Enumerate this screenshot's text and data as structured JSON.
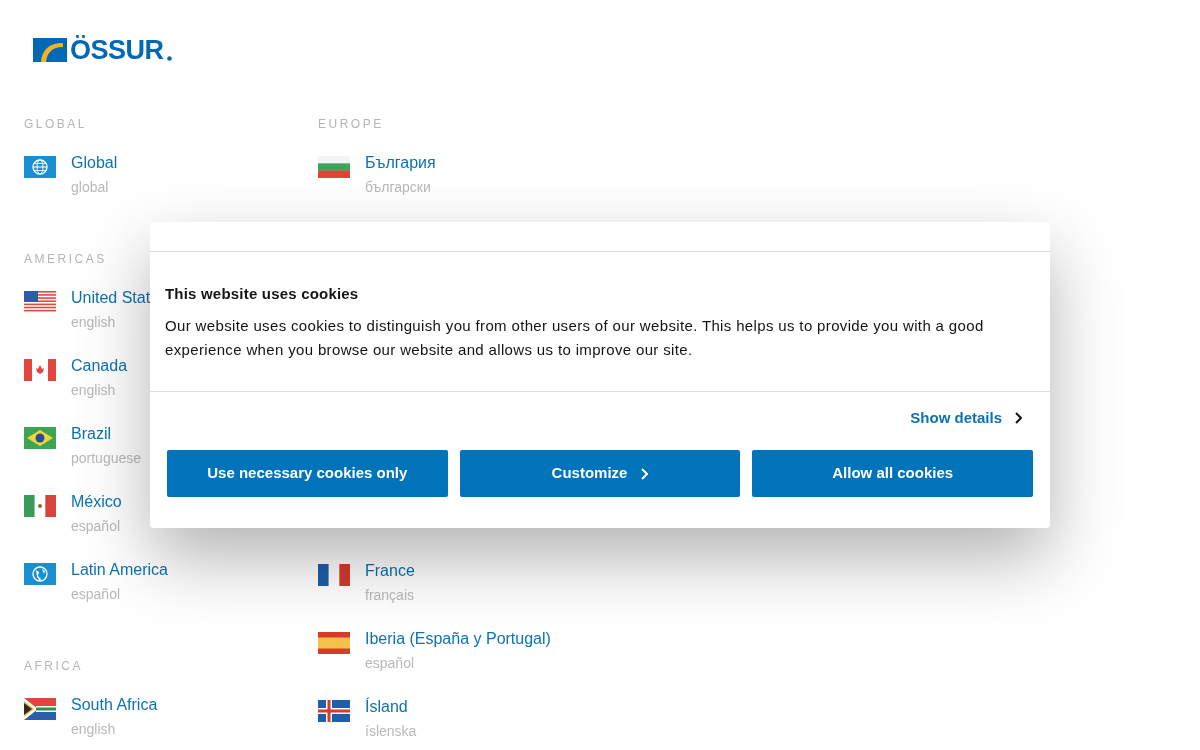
{
  "logo": {
    "text": "ÖSSUR"
  },
  "columns": [
    {
      "sections": [
        {
          "heading": "GLOBAL",
          "items": [
            {
              "kind": "globe",
              "name": "Global",
              "language": "global"
            }
          ]
        },
        {
          "heading": "AMERICAS",
          "items": [
            {
              "kind": "us",
              "name": "United Stat",
              "language": "english"
            },
            {
              "kind": "ca",
              "name": "Canada",
              "language": "english"
            },
            {
              "kind": "br",
              "name": "Brazil",
              "language": "portuguese"
            },
            {
              "kind": "mx",
              "name": "México",
              "language": "español"
            },
            {
              "kind": "latam",
              "name": "Latin America",
              "language": "español"
            }
          ]
        },
        {
          "heading": "AFRICA",
          "items": [
            {
              "kind": "za",
              "name": "South Africa",
              "language": "english"
            }
          ]
        }
      ]
    },
    {
      "sections": [
        {
          "heading": "EUROPE",
          "items": [
            {
              "kind": "bg",
              "name": "България",
              "language": "български"
            },
            {
              "kind": "fr",
              "name": "France",
              "language": "français"
            },
            {
              "kind": "es",
              "name": "Iberia (España y Portugal)",
              "language": "español"
            },
            {
              "kind": "is",
              "name": "Ísland",
              "language": "íslenska"
            }
          ]
        }
      ]
    }
  ],
  "cookie_dialog": {
    "title": "This website uses cookies",
    "body": "Our website uses cookies to distinguish you from other users of our website. This helps us to provide you with a good experience when you browse our website and allows us to improve our site.",
    "details_link": "Show details",
    "buttons": [
      {
        "label": "Use necessary cookies only",
        "chevron": false
      },
      {
        "label": "Customize",
        "chevron": true
      },
      {
        "label": "Allow all cookies",
        "chevron": false
      }
    ]
  }
}
